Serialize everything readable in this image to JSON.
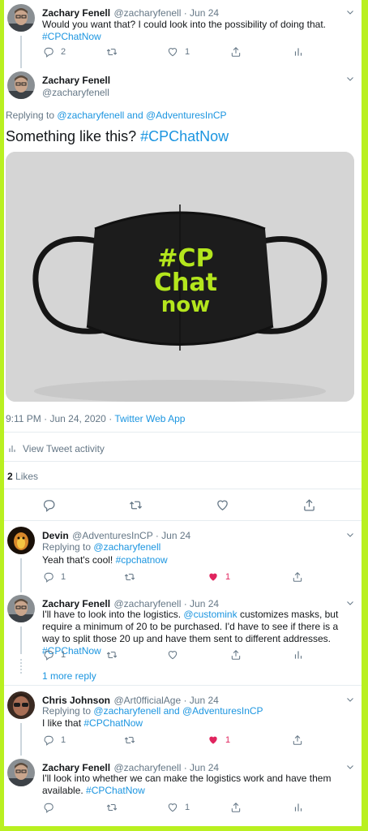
{
  "colors": {
    "accent": "#1b95e0",
    "like_active": "#e0245e",
    "frame": "#b9f020"
  },
  "tweet1": {
    "name": "Zachary Fenell",
    "handle_date": "@zacharyfenell · Jun 24",
    "text": "Would you want that? I could look into the possibility of doing that.",
    "hashtag": "#CPChatNow",
    "replies": "2",
    "likes": "1"
  },
  "main": {
    "name": "Zachary Fenell",
    "handle": "@zacharyfenell",
    "replying_prefix": "Replying to",
    "replying_user1": "@zacharyfenell",
    "replying_and": "and",
    "replying_user2": "@AdventuresInCP",
    "text": "Something like this?",
    "hashtag": "#CPChatNow",
    "image_text": [
      "#CP",
      "Chat",
      "now"
    ],
    "timestamp": "9:11 PM · Jun 24, 2020 ·",
    "source": "Twitter Web App",
    "activity": "View Tweet activity",
    "likes_count": "2",
    "likes_label": "Likes"
  },
  "reply_devin": {
    "name": "Devin",
    "handle_date": "@AdventuresInCP · Jun 24",
    "replying_prefix": "Replying to",
    "replying_user": "@zacharyfenell",
    "text": "Yeah that's cool!",
    "hashtag": "#cpchatnow",
    "replies": "1",
    "likes": "1"
  },
  "reply_zach2": {
    "name": "Zachary Fenell",
    "handle_date": "@zacharyfenell · Jun 24",
    "text_pre": "I'll have to look into the logistics.",
    "mention": "@customink",
    "text_mid": "customizes masks, but require a minimum of 20 to be purchased. I'd have to see if there is a way to split those 20 up and have them sent to different addresses.",
    "hashtag": "#CPChatNow",
    "replies": "1",
    "more_reply": "1 more reply"
  },
  "reply_chris": {
    "name": "Chris Johnson",
    "handle_date": "@Art0fficialAge · Jun 24",
    "replying_prefix": "Replying to",
    "replying_user1": "@zacharyfenell",
    "replying_and": "and",
    "replying_user2": "@AdventuresInCP",
    "text": "I like that",
    "hashtag": "#CPChatNow",
    "replies": "1",
    "likes": "1"
  },
  "reply_zach3": {
    "name": "Zachary Fenell",
    "handle_date": "@zacharyfenell · Jun 24",
    "text": "I'll look into whether we can make the logistics work and have them available.",
    "hashtag": "#CPChatNow",
    "likes": "1"
  }
}
